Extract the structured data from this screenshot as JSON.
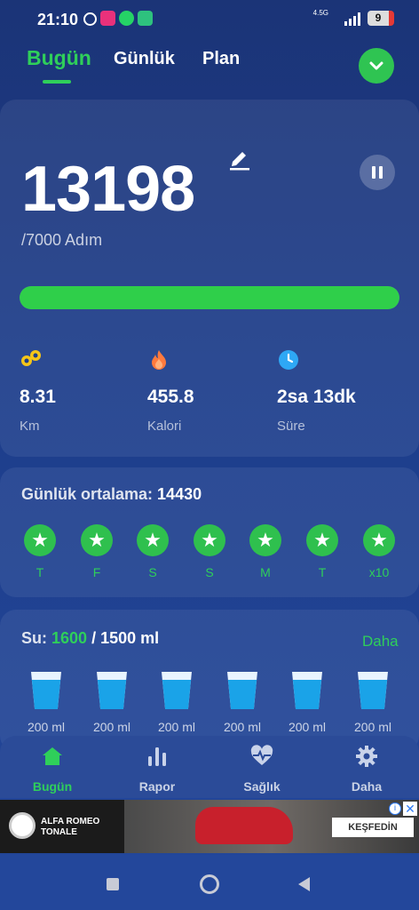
{
  "status_bar": {
    "time": "21:10",
    "network": "4.5G",
    "battery": "9",
    "icons": [
      "alarm-icon",
      "app-icon",
      "whatsapp-icon",
      "app-icon"
    ]
  },
  "tabs": [
    {
      "label": "Bugün",
      "active": true
    },
    {
      "label": "Günlük",
      "active": false
    },
    {
      "label": "Plan",
      "active": false
    }
  ],
  "steps": {
    "value": "13198",
    "goal_text": "/7000 Adım",
    "progress": 1.0
  },
  "stats": [
    {
      "icon": "footprints-icon",
      "value": "8.31",
      "label": "Km",
      "color": "#f5c518"
    },
    {
      "icon": "flame-icon",
      "value": "455.8",
      "label": "Kalori",
      "color": "#ff7a3d"
    },
    {
      "icon": "clock-icon",
      "value": "2sa 13dk",
      "label": "Süre",
      "color": "#2ea8f5"
    }
  ],
  "daily_average": {
    "label": "Günlük ortalama:",
    "value": "14430",
    "days": [
      "T",
      "F",
      "S",
      "S",
      "M",
      "T",
      "x10"
    ]
  },
  "water": {
    "label": "Su:",
    "current": "1600",
    "goal": "/ 1500 ml",
    "more": "Daha",
    "cups": [
      "200 ml",
      "200 ml",
      "200 ml",
      "200 ml",
      "200 ml",
      "200 ml"
    ]
  },
  "bottom_nav": [
    {
      "label": "Bugün",
      "icon": "home-icon",
      "active": true
    },
    {
      "label": "Rapor",
      "icon": "bar-chart-icon",
      "active": false
    },
    {
      "label": "Sağlık",
      "icon": "heart-pulse-icon",
      "active": false
    },
    {
      "label": "Daha",
      "icon": "gear-icon",
      "active": false
    }
  ],
  "ad": {
    "brand_line1": "ALFA ROMEO",
    "brand_line2": "TONALE",
    "cta": "KEŞFEDİN"
  },
  "colors": {
    "accent": "#2fcf5a",
    "background": "#1d3d8a"
  }
}
